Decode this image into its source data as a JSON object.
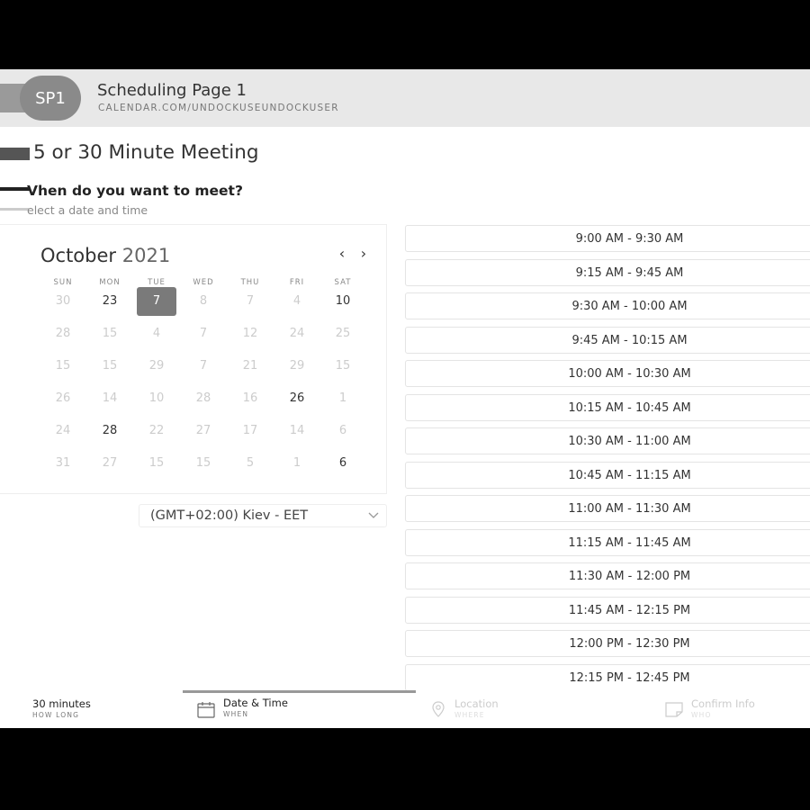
{
  "header": {
    "avatar": "SP1",
    "title": "Scheduling Page 1",
    "url": "CALENDAR.COM/UNDOCKUSEUNDOCKUSER"
  },
  "event": {
    "title": "5 or 30 Minute Meeting",
    "question": "Vhen do you want to meet?",
    "subtitle": "elect a date and time"
  },
  "calendar": {
    "month": "October",
    "year": "2021",
    "prev_label": "‹",
    "next_label": "›",
    "weekdays": [
      "SUN",
      "MON",
      "TUE",
      "WED",
      "THU",
      "FRI",
      "SAT"
    ],
    "weeks": [
      [
        "30",
        "23",
        "7",
        "8",
        "7",
        "4",
        "10"
      ],
      [
        "28",
        "15",
        "4",
        "7",
        "12",
        "24",
        "25"
      ],
      [
        "15",
        "15",
        "29",
        "7",
        "21",
        "29",
        "15"
      ],
      [
        "26",
        "14",
        "10",
        "28",
        "16",
        "26",
        "1"
      ],
      [
        "24",
        "28",
        "22",
        "27",
        "17",
        "14",
        "6"
      ],
      [
        "31",
        "27",
        "15",
        "15",
        "5",
        "1",
        "6"
      ]
    ],
    "available": [
      [
        0,
        1
      ],
      [
        0,
        2
      ],
      [
        0,
        6
      ],
      [
        3,
        5
      ],
      [
        4,
        1
      ],
      [
        5,
        6
      ]
    ],
    "selected": [
      0,
      2
    ]
  },
  "timezone": {
    "value": "(GMT+02:00) Kiev - EET"
  },
  "slots": [
    "9:00 AM - 9:30 AM",
    "9:15 AM - 9:45 AM",
    "9:30 AM - 10:00 AM",
    "9:45 AM - 10:15 AM",
    "10:00 AM - 10:30 AM",
    "10:15 AM - 10:45 AM",
    "10:30 AM - 11:00 AM",
    "10:45 AM - 11:15 AM",
    "11:00 AM - 11:30 AM",
    "11:15 AM - 11:45 AM",
    "11:30 AM - 12:00 PM",
    "11:45 AM - 12:15 PM",
    "12:00 PM - 12:30 PM",
    "12:15 PM - 12:45 PM"
  ],
  "footer": {
    "duration": "30 minutes",
    "duration_sub": "HOW LONG",
    "datetime": "Date & Time",
    "datetime_sub": "WHEN",
    "location": "Location",
    "location_sub": "WHERE",
    "confirm": "Confirm Info",
    "confirm_sub": "WHO"
  },
  "colors": {
    "selected_day": "#7a7a7a",
    "header_bg": "#e8e8e8",
    "avatar_bg": "#8a8a8a"
  }
}
